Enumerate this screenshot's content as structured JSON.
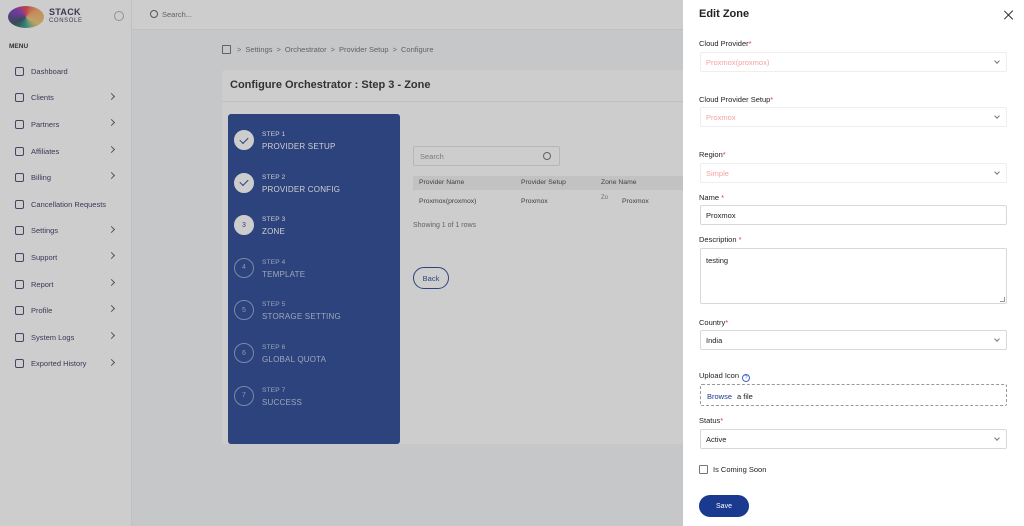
{
  "app": {
    "logo_line1": "STACK",
    "logo_line2": "CONSOLE"
  },
  "topbar": {
    "search_placeholder": "Search..."
  },
  "sidebar": {
    "menu_label": "MENU",
    "items": [
      {
        "label": "Dashboard",
        "icon": "home-icon",
        "has_chevron": false
      },
      {
        "label": "Clients",
        "icon": "user-icon",
        "has_chevron": true
      },
      {
        "label": "Partners",
        "icon": "users-icon",
        "has_chevron": true
      },
      {
        "label": "Affiliates",
        "icon": "handshake-icon",
        "has_chevron": true
      },
      {
        "label": "Billing",
        "icon": "receipt-icon",
        "has_chevron": true
      },
      {
        "label": "Cancellation Requests",
        "icon": "document-icon",
        "has_chevron": false
      },
      {
        "label": "Settings",
        "icon": "gear-icon",
        "has_chevron": true
      },
      {
        "label": "Support",
        "icon": "headset-icon",
        "has_chevron": true
      },
      {
        "label": "Report",
        "icon": "report-icon",
        "has_chevron": true
      },
      {
        "label": "Profile",
        "icon": "profile-icon",
        "has_chevron": true
      },
      {
        "label": "System Logs",
        "icon": "warning-icon",
        "has_chevron": true
      },
      {
        "label": "Exported History",
        "icon": "export-icon",
        "has_chevron": true
      }
    ]
  },
  "breadcrumb": [
    "Settings",
    "Orchestrator",
    "Provider Setup",
    "Configure"
  ],
  "page": {
    "title": "Configure Orchestrator : Step 3 - Zone"
  },
  "steps": [
    {
      "num": "STEP 1",
      "name": "PROVIDER SETUP",
      "state": "done",
      "marker": ""
    },
    {
      "num": "STEP 2",
      "name": "PROVIDER CONFIG",
      "state": "done",
      "marker": ""
    },
    {
      "num": "STEP 3",
      "name": "ZONE",
      "state": "current",
      "marker": "3"
    },
    {
      "num": "STEP 4",
      "name": "TEMPLATE",
      "state": "pending",
      "marker": "4"
    },
    {
      "num": "STEP 5",
      "name": "STORAGE SETTING",
      "state": "pending",
      "marker": "5"
    },
    {
      "num": "STEP 6",
      "name": "GLOBAL QUOTA",
      "state": "pending",
      "marker": "6"
    },
    {
      "num": "STEP 7",
      "name": "SUCCESS",
      "state": "pending",
      "marker": "7"
    }
  ],
  "table": {
    "search_placeholder": "Search",
    "headers": [
      "Provider Name",
      "Provider Setup",
      "Zone Name"
    ],
    "rows": [
      [
        "Proxmox(proxmox)",
        "Proxmox",
        "Proxmox"
      ]
    ],
    "zone_icon_alt": "Zo",
    "info": "Showing 1 of 1 rows",
    "back_label": "Back"
  },
  "drawer": {
    "title": "Edit Zone",
    "cloud_provider": {
      "label": "Cloud Provider",
      "value": "Proxmox(proxmox)"
    },
    "cloud_provider_setup": {
      "label": "Cloud Provider Setup",
      "value": "Proxmox"
    },
    "region": {
      "label": "Region",
      "value": "Simple"
    },
    "name": {
      "label": "Name ",
      "value": "Proxmox"
    },
    "description": {
      "label": "Description ",
      "value": "testing"
    },
    "country": {
      "label": "Country",
      "value": "India"
    },
    "upload_icon": {
      "label": "Upload Icon",
      "browse": "Browse",
      "rest": " a file"
    },
    "status": {
      "label": "Status",
      "value": "Active"
    },
    "coming_soon_label": "Is Coming Soon",
    "save_label": "Save",
    "required_mark": "*"
  },
  "colors": {
    "primary": "#1a3a8f",
    "required": "#e53935"
  }
}
